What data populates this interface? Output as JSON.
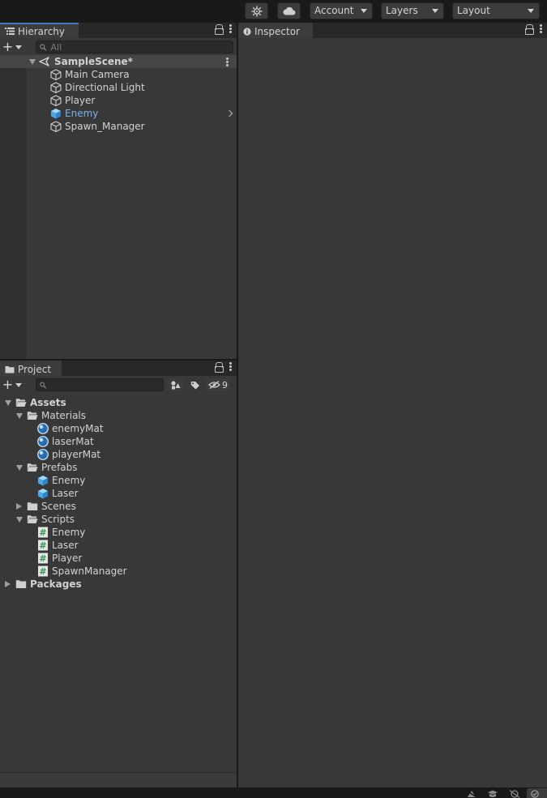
{
  "toolbar": {
    "account_label": "Account",
    "layers_label": "Layers",
    "layout_label": "Layout",
    "services_icon": "services-icon",
    "cloud_icon": "cloud-icon"
  },
  "hierarchy": {
    "tab_label": "Hierarchy",
    "search_placeholder": "All",
    "scene_name": "SampleScene*",
    "items": [
      {
        "label": "Main Camera",
        "icon": "gameobject-icon"
      },
      {
        "label": "Directional Light",
        "icon": "gameobject-icon"
      },
      {
        "label": "Player",
        "icon": "gameobject-icon"
      },
      {
        "label": "Enemy",
        "icon": "prefab-icon",
        "selected": true
      },
      {
        "label": "Spawn_Manager",
        "icon": "gameobject-icon"
      }
    ]
  },
  "inspector": {
    "tab_label": "Inspector"
  },
  "project": {
    "tab_label": "Project",
    "search_placeholder": "",
    "hidden_count": "9",
    "tree": {
      "assets": "Assets",
      "materials": "Materials",
      "material_items": [
        "enemyMat",
        "laserMat",
        "playerMat"
      ],
      "prefabs": "Prefabs",
      "prefab_items": [
        "Enemy",
        "Laser"
      ],
      "scenes": "Scenes",
      "scripts": "Scripts",
      "script_items": [
        "Enemy",
        "Laser",
        "Player",
        "SpawnManager"
      ],
      "packages": "Packages"
    }
  },
  "colors": {
    "tab_accent": "#3a79bb",
    "selected_text": "#7ab1f0",
    "panel_bg": "#383838",
    "prefab_blue": "#5bb8f0",
    "script_green": "#52c26b"
  }
}
